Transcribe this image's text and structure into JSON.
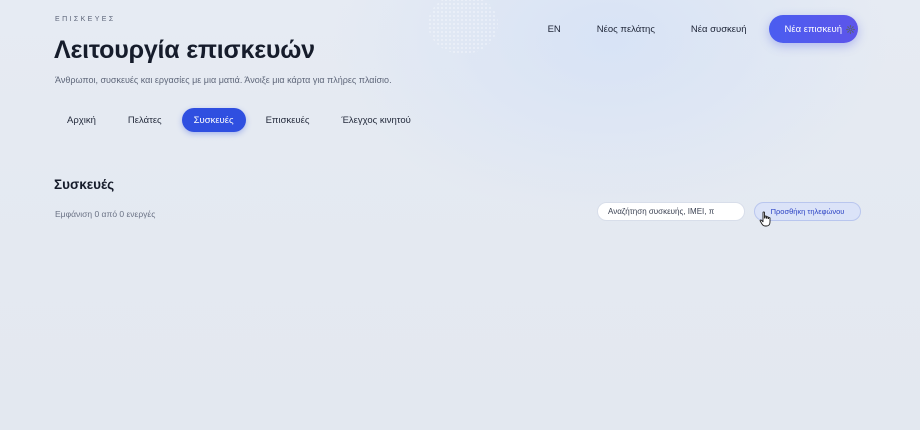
{
  "brand": "ΕΠΙΣΚΕΥΕΣ",
  "page": {
    "title": "Λειτουργία επισκευών",
    "subtitle": "Άνθρωποι, συσκευές και εργασίες με μια ματιά. Άνοιξε μια κάρτα για πλήρες πλαίσιο."
  },
  "topbar": {
    "lang_label": "EN",
    "new_customer_label": "Νέος πελάτης",
    "new_device_label": "Νέα συσκευή",
    "new_repair_label": "Νέα επισκευή",
    "settings_icon": "gear-icon"
  },
  "tabs": [
    {
      "label": "Αρχική",
      "active": false
    },
    {
      "label": "Πελάτες",
      "active": false
    },
    {
      "label": "Συσκευές",
      "active": true
    },
    {
      "label": "Επισκευές",
      "active": false
    },
    {
      "label": "Έλεγχος κινητού",
      "active": false
    }
  ],
  "devices": {
    "title": "Συσκευές",
    "count_text": "Εμφάνιση 0 από 0 ενεργές",
    "search_placeholder": "Αναζήτηση συσκευής, IMEI, π",
    "add_label": "Προσθήκη τηλεφώνου"
  },
  "colors": {
    "primary": "#4a5df0",
    "tab_active": "#2f4fe0",
    "background": "#e5eaf2"
  }
}
